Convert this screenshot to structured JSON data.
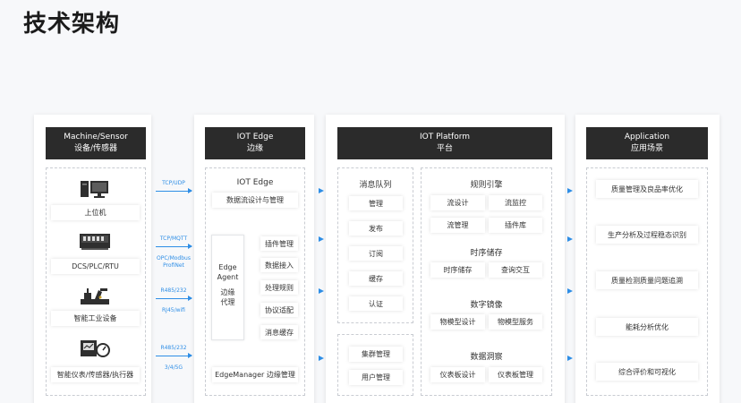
{
  "title": "技术架构",
  "columns": {
    "device": {
      "title_en": "Machine/Sensor",
      "title_cn": "设备/传感器",
      "items": [
        "上位机",
        "DCS/PLC/RTU",
        "智能工业设备",
        "智能仪表/传感器/执行器"
      ]
    },
    "edge": {
      "title_en": "IOT Edge",
      "title_cn": "边缘",
      "section": "IOT Edge",
      "design": "数据流设计与管理",
      "agent": "Edge Agent",
      "agent_cn": "边缘代理",
      "plugins": [
        "插件管理",
        "数据接入",
        "处理规则",
        "协议适配",
        "消息缓存"
      ],
      "manager": "EdgeManager 边缘管理"
    },
    "platform": {
      "title_en": "IOT Platform",
      "title_cn": "平台",
      "mq_title": "消息队列",
      "mq": [
        "管理",
        "发布",
        "订阅",
        "缓存",
        "认证"
      ],
      "cluster": [
        "集群管理",
        "用户管理"
      ],
      "rule_title": "规则引擎",
      "rules": [
        "流设计",
        "流监控",
        "流管理",
        "插件库"
      ],
      "ts_title": "时序储存",
      "ts": [
        "时序储存",
        "查询交互"
      ],
      "twin_title": "数字镜像",
      "twin": [
        "物模型设计",
        "物模型服务"
      ],
      "insight_title": "数据洞察",
      "insight": [
        "仪表板设计",
        "仪表板管理"
      ]
    },
    "app": {
      "title_en": "Application",
      "title_cn": "应用场景",
      "items": [
        "质量管理及良品率优化",
        "生产分析及过程稳态识别",
        "质量检测质量问题追溯",
        "能耗分析优化",
        "综合评价和可视化"
      ]
    }
  },
  "protocols": [
    "TCP/UDP",
    "TCP/MQTT",
    "OPC/Modbus",
    "ProfiNet",
    "R485/232",
    "RJ45/wifi",
    "R485/232",
    "3/4/5G"
  ],
  "colors": {
    "accent": "#2e8ee6",
    "header": "#2b2b2b"
  },
  "icons": [
    "computer-icon",
    "plc-rack-icon",
    "industrial-robot-icon",
    "meter-gauge-icon"
  ]
}
